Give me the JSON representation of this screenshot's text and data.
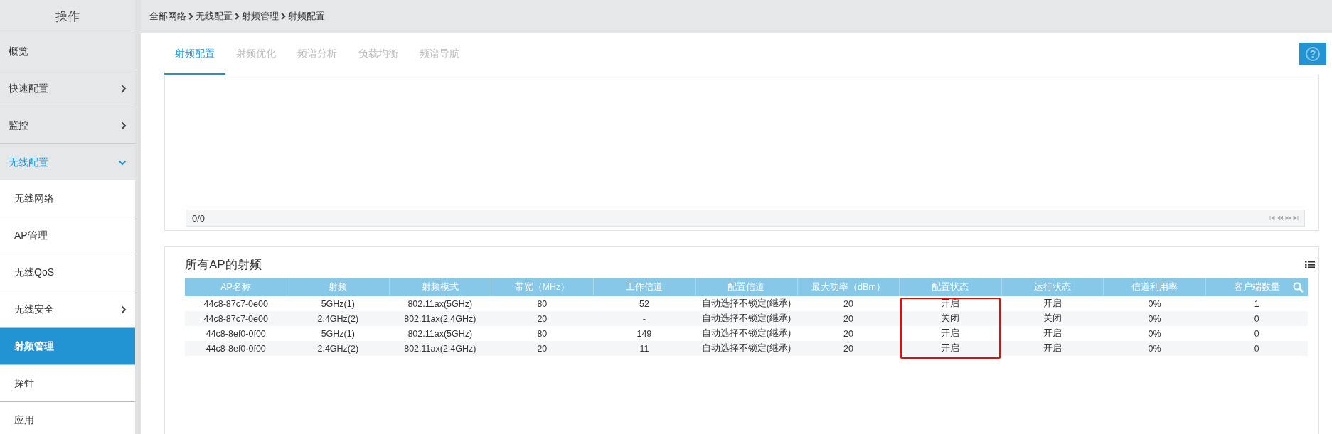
{
  "sidebar": {
    "title": "操作",
    "items": [
      {
        "label": "概览",
        "has_submenu": false,
        "expanded": false
      },
      {
        "label": "快速配置",
        "has_submenu": true,
        "expanded": false
      },
      {
        "label": "监控",
        "has_submenu": true,
        "expanded": false
      },
      {
        "label": "无线配置",
        "has_submenu": true,
        "expanded": true,
        "children": [
          {
            "label": "无线网络",
            "has_submenu": false,
            "selected": false
          },
          {
            "label": "AP管理",
            "has_submenu": false,
            "selected": false
          },
          {
            "label": "无线QoS",
            "has_submenu": false,
            "selected": false
          },
          {
            "label": "无线安全",
            "has_submenu": true,
            "selected": false
          },
          {
            "label": "射频管理",
            "has_submenu": false,
            "selected": true
          },
          {
            "label": "探针",
            "has_submenu": false,
            "selected": false
          },
          {
            "label": "应用",
            "has_submenu": false,
            "selected": false
          }
        ]
      }
    ]
  },
  "breadcrumb": [
    "全部网络",
    "无线配置",
    "射频管理",
    "射频配置"
  ],
  "tabs": [
    {
      "label": "射频配置",
      "selected": true
    },
    {
      "label": "射频优化",
      "selected": false
    },
    {
      "label": "频谱分析",
      "selected": false
    },
    {
      "label": "负载均衡",
      "selected": false
    },
    {
      "label": "频谱导航",
      "selected": false
    }
  ],
  "help_button": {
    "label": "?"
  },
  "top_panel": {
    "pagination": {
      "page": "0/0"
    }
  },
  "radio_panel": {
    "title": "所有AP的射频",
    "columns": [
      {
        "label": "AP名称",
        "highlighted": false
      },
      {
        "label": "射频",
        "highlighted": false
      },
      {
        "label": "射频模式",
        "highlighted": false
      },
      {
        "label": "带宽（MHz）",
        "highlighted": false
      },
      {
        "label": "工作信道",
        "highlighted": false
      },
      {
        "label": "配置信道",
        "highlighted": false
      },
      {
        "label": "最大功率（dBm）",
        "highlighted": false
      },
      {
        "label": "配置状态",
        "highlighted": true
      },
      {
        "label": "运行状态",
        "highlighted": false
      },
      {
        "label": "信道利用率",
        "highlighted": false
      },
      {
        "label": "客户端数量",
        "highlighted": false
      }
    ],
    "rows": [
      [
        "44c8-87c7-0e00",
        "5GHz(1)",
        "802.11ax(5GHz)",
        "80",
        "52",
        "自动选择不锁定(继承)",
        "20",
        "开启",
        "开启",
        "0%",
        "1"
      ],
      [
        "44c8-87c7-0e00",
        "2.4GHz(2)",
        "802.11ax(2.4GHz)",
        "20",
        "-",
        "自动选择不锁定(继承)",
        "20",
        "关闭",
        "关闭",
        "0%",
        "0"
      ],
      [
        "44c8-8ef0-0f00",
        "5GHz(1)",
        "802.11ax(5GHz)",
        "80",
        "149",
        "自动选择不锁定(继承)",
        "20",
        "开启",
        "开启",
        "0%",
        "0"
      ],
      [
        "44c8-8ef0-0f00",
        "2.4GHz(2)",
        "802.11ax(2.4GHz)",
        "20",
        "11",
        "自动选择不锁定(继承)",
        "20",
        "开启",
        "开启",
        "0%",
        "0"
      ]
    ]
  }
}
